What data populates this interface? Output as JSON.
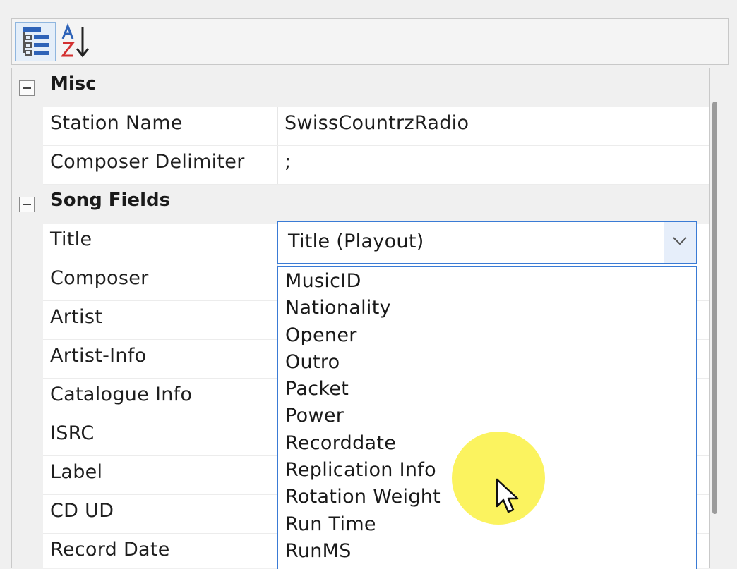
{
  "toolbar": {
    "categorized_icon": "categorized-list-icon",
    "alphabetical_icon": "sort-az-icon"
  },
  "grid": {
    "categories": [
      {
        "label": "Misc",
        "properties": [
          {
            "name": "Station Name",
            "value": "SwissCountrzRadio"
          },
          {
            "name": "Composer Delimiter",
            "value": ";"
          }
        ]
      },
      {
        "label": "Song Fields",
        "properties": [
          {
            "name": "Title",
            "value": "Title (Playout)"
          },
          {
            "name": "Composer",
            "value": ""
          },
          {
            "name": "Artist",
            "value": ""
          },
          {
            "name": "Artist-Info",
            "value": ""
          },
          {
            "name": "Catalogue Info",
            "value": ""
          },
          {
            "name": "ISRC",
            "value": ""
          },
          {
            "name": "Label",
            "value": ""
          },
          {
            "name": "CD UD",
            "value": ""
          },
          {
            "name": "Record Date",
            "value": ""
          }
        ]
      }
    ]
  },
  "dropdown": {
    "selected": "Title (Playout)",
    "options": [
      "MusicID",
      "Nationality",
      "Opener",
      "Outro",
      "Packet",
      "Power",
      "Recorddate",
      "Replication Info",
      "Rotation Weight",
      "Run Time",
      "RunMS"
    ]
  },
  "colors": {
    "accent": "#3a7bd5",
    "highlight": "#faf03c",
    "background": "#f0f0f0"
  }
}
